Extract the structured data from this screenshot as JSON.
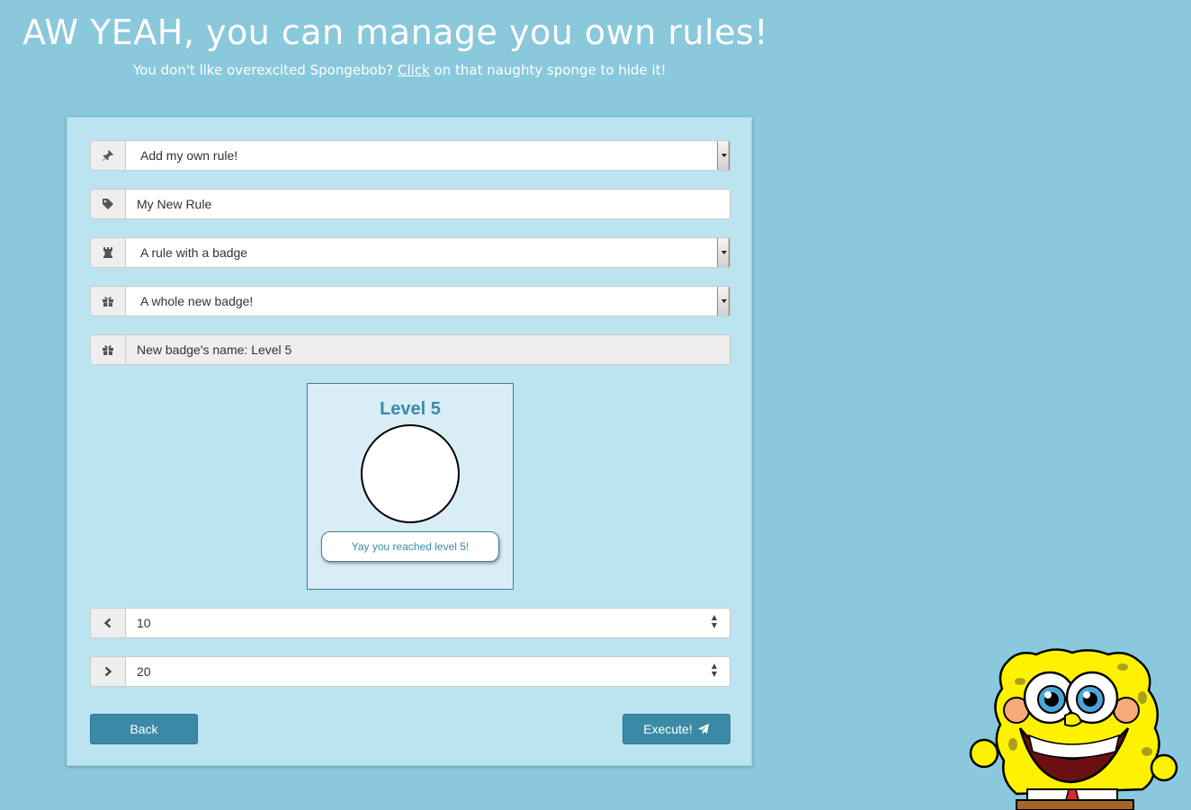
{
  "header": {
    "title": "AW YEAH, you can manage you own rules!",
    "subtitle_before": "You don't like overexcited Spongebob? ",
    "subtitle_link": "Click",
    "subtitle_after": " on that naughty sponge to hide it!"
  },
  "form": {
    "rule_type": {
      "icon": "pin-icon",
      "value": "Add my own rule!"
    },
    "rule_name": {
      "icon": "tag-icon",
      "value": "My New Rule"
    },
    "rule_kind": {
      "icon": "rook-icon",
      "value": "A rule with a badge"
    },
    "badge_source": {
      "icon": "gift-icon",
      "value": "A whole new badge!"
    },
    "badge_name": {
      "icon": "gift-icon",
      "value": "New badge's name: Level 5"
    },
    "min_value": {
      "icon": "chevron-left-icon",
      "value": "10"
    },
    "max_value": {
      "icon": "chevron-right-icon",
      "value": "20"
    }
  },
  "badge_preview": {
    "title": "Level 5",
    "description": "Yay you reached level 5!"
  },
  "buttons": {
    "back": "Back",
    "execute": "Execute!"
  },
  "colors": {
    "background": "#8ac8dc",
    "panel": "#bce3f0",
    "accent": "#3a8aa6"
  },
  "mascot": {
    "icon": "spongebob-illustration"
  }
}
